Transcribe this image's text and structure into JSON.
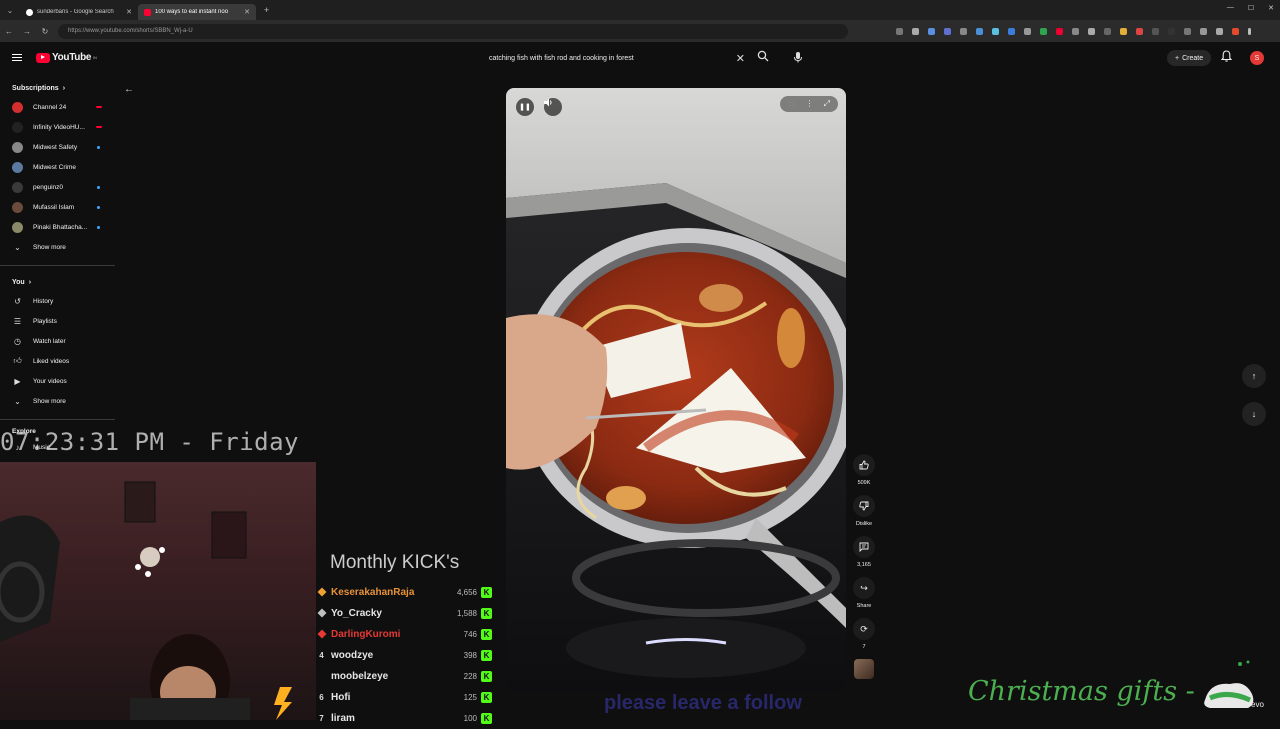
{
  "browser": {
    "tabs": [
      {
        "title": "sunderbans - Google Search",
        "active": false
      },
      {
        "title": "100 ways to eat instant noo",
        "active": true
      }
    ],
    "url": "https://www.youtube.com/shorts/SBBN_Wj-a-U"
  },
  "header": {
    "logo_text": "YouTube",
    "logo_sup": "IN",
    "search_query": "catching fish with fish rod and cooking in forest",
    "create_label": "Create",
    "avatar_letter": "S"
  },
  "sidebar": {
    "subscriptions_title": "Subscriptions",
    "subscriptions": [
      {
        "name": "Channel 24",
        "color": "#d32f2f",
        "badge": "live"
      },
      {
        "name": "Infinity VideoHU...",
        "color": "#222222",
        "badge": "live"
      },
      {
        "name": "Midwest Safety",
        "color": "#888888",
        "badge": "dot"
      },
      {
        "name": "Midwest Crime",
        "color": "#5a7aa0",
        "badge": "none"
      },
      {
        "name": "penguinz0",
        "color": "#3a3a3a",
        "badge": "dot"
      },
      {
        "name": "Mufassil Islam",
        "color": "#6b4b3b",
        "badge": "dot"
      },
      {
        "name": "Pinaki Bhattacha...",
        "color": "#8a8a6a",
        "badge": "dot"
      }
    ],
    "subs_show_more": "Show more",
    "you_title": "You",
    "you_items": [
      {
        "label": "History",
        "icon": "history-icon"
      },
      {
        "label": "Playlists",
        "icon": "playlists-icon"
      },
      {
        "label": "Watch later",
        "icon": "clock-icon"
      },
      {
        "label": "Liked videos",
        "icon": "thumbs-up-icon"
      },
      {
        "label": "Your videos",
        "icon": "video-icon"
      }
    ],
    "you_show_more": "Show more",
    "explore_title": "Explore",
    "explore_items": [
      {
        "label": "Music"
      }
    ]
  },
  "actions": {
    "like_count": "509K",
    "dislike_label": "Dislike",
    "comment_count": "3,165",
    "share_label": "Share",
    "remix_count": "7"
  },
  "overlay": {
    "clock": "07:23:31 PM - Friday",
    "leaderboard_title": "Monthly KICK's",
    "leaderboard": [
      {
        "rank": "",
        "name": "KeserakahanRaja",
        "value": "4,656",
        "color": "#e8923a",
        "medal": "#f0a030"
      },
      {
        "rank": "",
        "name": "Yo_Cracky",
        "value": "1,588",
        "color": "#e6e6e6",
        "medal": "#c0c0c0"
      },
      {
        "rank": "",
        "name": "DarlingKuromi",
        "value": "746",
        "color": "#e53935",
        "medal": "#e53935"
      },
      {
        "rank": "4",
        "name": "woodzye",
        "value": "398",
        "color": "#e6e6e6",
        "medal": ""
      },
      {
        "rank": "",
        "name": "moobelzeye",
        "value": "228",
        "color": "#e6e6e6",
        "medal": ""
      },
      {
        "rank": "6",
        "name": "Hofi",
        "value": "125",
        "color": "#e6e6e6",
        "medal": ""
      },
      {
        "rank": "7",
        "name": "liram",
        "value": "100",
        "color": "#e6e6e6",
        "medal": ""
      }
    ],
    "ticker": "please leave a follow",
    "xmas_text": "Christmas gifts -",
    "vevo": "vevo"
  }
}
